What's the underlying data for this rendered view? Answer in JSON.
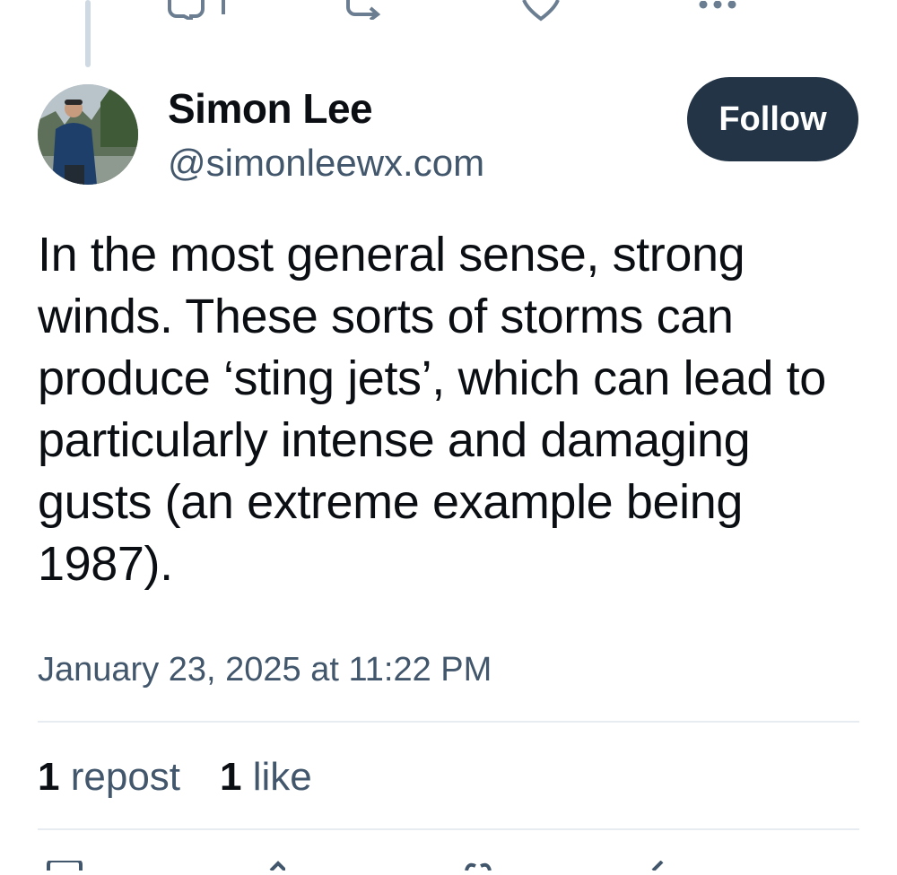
{
  "post": {
    "author_name": "Simon Lee",
    "author_handle": "@simonleewx.com",
    "follow_label": "Follow",
    "text": "In the most general sense, strong winds. These sorts of storms can produce ‘sting jets’, which can lead to particularly intense and damaging gusts (an extreme example being 1987).",
    "timestamp": "January 23, 2025 at 11:22 PM"
  },
  "stats": {
    "reposts_count": "1",
    "reposts_label": "repost",
    "likes_count": "1",
    "likes_label": "like"
  },
  "colors": {
    "follow_bg": "#233446",
    "muted_text": "#42576c",
    "icon": "#6b7d90",
    "thread_line": "#cfd9e3"
  },
  "icons": [
    "reply-icon",
    "repost-icon",
    "like-icon",
    "more-icon",
    "avatar"
  ]
}
